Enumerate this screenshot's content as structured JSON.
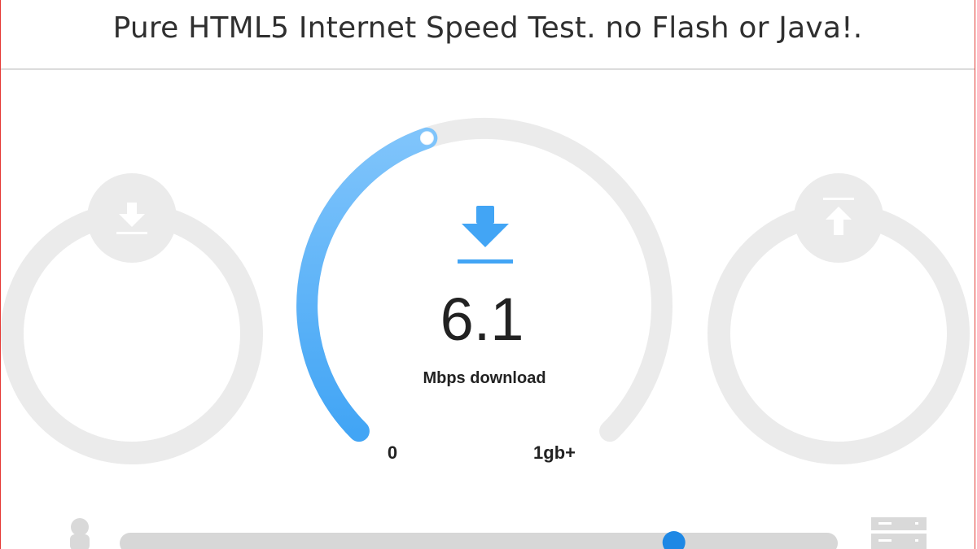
{
  "header": {
    "title": "Pure HTML5 Internet Speed Test. no Flash or Java!."
  },
  "main_gauge": {
    "value": "6.1",
    "unit_label": "Mbps download",
    "scale_min_label": "0",
    "scale_max_label": "1gb+",
    "fill_fraction": 0.43,
    "icon": "download-arrow-icon"
  },
  "left_gauge": {
    "icon": "download-arrow-icon"
  },
  "right_gauge": {
    "icon": "upload-arrow-icon"
  },
  "progress": {
    "fraction": 0.78,
    "left_icon": "person-icon",
    "right_icon": "server-icon"
  },
  "colors": {
    "accent": "#42a5f5",
    "accent_light": "#7fc4fb",
    "track": "#ebebeb",
    "text_dark": "#222222",
    "frame_border": "#e53935",
    "progress_track": "#d7d7d7",
    "progress_thumb": "#1e88e5"
  }
}
